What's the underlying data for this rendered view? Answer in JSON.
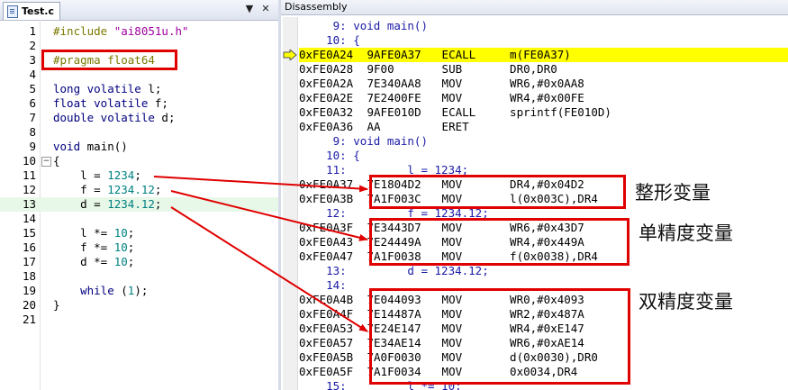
{
  "editor": {
    "tab_label": "Test.c",
    "lines": [
      {
        "n": "1",
        "parts": [
          [
            "pp",
            "#include "
          ],
          [
            "str",
            "\"ai8051u.h\""
          ]
        ]
      },
      {
        "n": "2",
        "parts": []
      },
      {
        "n": "3",
        "parts": [
          [
            "pp",
            "#pragma float64"
          ]
        ]
      },
      {
        "n": "4",
        "parts": []
      },
      {
        "n": "5",
        "parts": [
          [
            "kw",
            "long volatile "
          ],
          [
            "",
            "l;"
          ]
        ]
      },
      {
        "n": "6",
        "parts": [
          [
            "kw",
            "float volatile "
          ],
          [
            "",
            "f;"
          ]
        ]
      },
      {
        "n": "7",
        "parts": [
          [
            "kw",
            "double volatile "
          ],
          [
            "",
            "d;"
          ]
        ]
      },
      {
        "n": "8",
        "parts": []
      },
      {
        "n": "9",
        "parts": [
          [
            "kw",
            "void "
          ],
          [
            "",
            "main()"
          ]
        ]
      },
      {
        "n": "10",
        "parts": [
          [
            "",
            "{"
          ]
        ],
        "fold": "−"
      },
      {
        "n": "11",
        "parts": [
          [
            "",
            "    l = "
          ],
          [
            "num",
            "1234"
          ],
          [
            "",
            ";"
          ]
        ]
      },
      {
        "n": "12",
        "parts": [
          [
            "",
            "    f = "
          ],
          [
            "num",
            "1234.12"
          ],
          [
            "",
            ";"
          ]
        ]
      },
      {
        "n": "13",
        "parts": [
          [
            "",
            "    d = "
          ],
          [
            "num",
            "1234.12"
          ],
          [
            "",
            ";"
          ]
        ],
        "current": true
      },
      {
        "n": "14",
        "parts": []
      },
      {
        "n": "15",
        "parts": [
          [
            "",
            "    l *= "
          ],
          [
            "num",
            "10"
          ],
          [
            "",
            ";"
          ]
        ]
      },
      {
        "n": "16",
        "parts": [
          [
            "",
            "    f *= "
          ],
          [
            "num",
            "10"
          ],
          [
            "",
            ";"
          ]
        ]
      },
      {
        "n": "17",
        "parts": [
          [
            "",
            "    d *= "
          ],
          [
            "num",
            "10"
          ],
          [
            "",
            ";"
          ]
        ]
      },
      {
        "n": "18",
        "parts": []
      },
      {
        "n": "19",
        "parts": [
          [
            "kw",
            "    while "
          ],
          [
            "",
            "("
          ],
          [
            "num",
            "1"
          ],
          [
            "",
            ");"
          ]
        ]
      },
      {
        "n": "20",
        "parts": [
          [
            "",
            "}"
          ]
        ]
      },
      {
        "n": "21",
        "parts": []
      }
    ]
  },
  "disassembly": {
    "title": "Disassembly",
    "lines": [
      {
        "type": "src",
        "text": "     9: void main()"
      },
      {
        "type": "src",
        "text": "    10: {"
      },
      {
        "type": "asm",
        "addr": "0xFE0A24",
        "code": "9AFE0A37",
        "op": "ECALL",
        "arg": "m(FE0A37)",
        "current": true
      },
      {
        "type": "asm",
        "addr": "0xFE0A28",
        "code": "9F00",
        "op": "SUB",
        "arg": "DR0,DR0"
      },
      {
        "type": "asm",
        "addr": "0xFE0A2A",
        "code": "7E340AA8",
        "op": "MOV",
        "arg": "WR6,#0x0AA8"
      },
      {
        "type": "asm",
        "addr": "0xFE0A2E",
        "code": "7E2400FE",
        "op": "MOV",
        "arg": "WR4,#0x00FE"
      },
      {
        "type": "asm",
        "addr": "0xFE0A32",
        "code": "9AFE010D",
        "op": "ECALL",
        "arg": "sprintf(FE010D)"
      },
      {
        "type": "asm",
        "addr": "0xFE0A36",
        "code": "AA",
        "op": "ERET",
        "arg": ""
      },
      {
        "type": "src",
        "text": "     9: void main()"
      },
      {
        "type": "src",
        "text": "    10: {"
      },
      {
        "type": "src",
        "text": "    11:         l = 1234;"
      },
      {
        "type": "asm",
        "addr": "0xFE0A37",
        "code": "7E1804D2",
        "op": "MOV",
        "arg": "DR4,#0x04D2"
      },
      {
        "type": "asm",
        "addr": "0xFE0A3B",
        "code": "7A1F003C",
        "op": "MOV",
        "arg": "l(0x003C),DR4"
      },
      {
        "type": "src",
        "text": "    12:         f = 1234.12;"
      },
      {
        "type": "asm",
        "addr": "0xFE0A3F",
        "code": "7E3443D7",
        "op": "MOV",
        "arg": "WR6,#0x43D7"
      },
      {
        "type": "asm",
        "addr": "0xFE0A43",
        "code": "7E24449A",
        "op": "MOV",
        "arg": "WR4,#0x449A"
      },
      {
        "type": "asm",
        "addr": "0xFE0A47",
        "code": "7A1F0038",
        "op": "MOV",
        "arg": "f(0x0038),DR4"
      },
      {
        "type": "src",
        "text": "    13:         d = 1234.12;"
      },
      {
        "type": "src",
        "text": "    14:"
      },
      {
        "type": "asm",
        "addr": "0xFE0A4B",
        "code": "7E044093",
        "op": "MOV",
        "arg": "WR0,#0x4093"
      },
      {
        "type": "asm",
        "addr": "0xFE0A4F",
        "code": "7E14487A",
        "op": "MOV",
        "arg": "WR2,#0x487A"
      },
      {
        "type": "asm",
        "addr": "0xFE0A53",
        "code": "7E24E147",
        "op": "MOV",
        "arg": "WR4,#0xE147"
      },
      {
        "type": "asm",
        "addr": "0xFE0A57",
        "code": "7E34AE14",
        "op": "MOV",
        "arg": "WR6,#0xAE14"
      },
      {
        "type": "asm",
        "addr": "0xFE0A5B",
        "code": "7A0F0030",
        "op": "MOV",
        "arg": "d(0x0030),DR0"
      },
      {
        "type": "asm",
        "addr": "0xFE0A5F",
        "code": "7A1F0034",
        "op": "MOV",
        "arg": "0x0034,DR4"
      },
      {
        "type": "src",
        "text": "    15:         l *= 10;"
      }
    ]
  },
  "annotations": {
    "int_label": "整形变量",
    "float_label": "单精度变量",
    "double_label": "双精度变量"
  },
  "colors": {
    "highlight": "#ffff00",
    "annotation": "#e00000",
    "current_line": "#e8f8e8"
  }
}
